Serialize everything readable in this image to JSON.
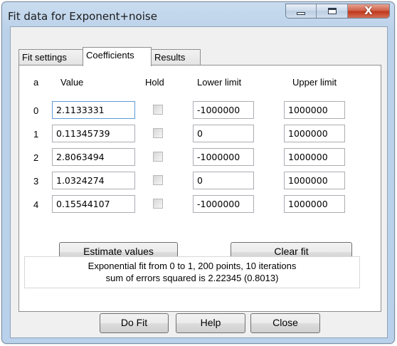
{
  "window": {
    "title": "Fit data for Exponent+noise"
  },
  "caption_buttons": {
    "close_glyph": "X"
  },
  "tabs": [
    {
      "label": "Fit settings",
      "active": false
    },
    {
      "label": "Coefficients",
      "active": true
    },
    {
      "label": "Results",
      "active": false
    }
  ],
  "coefficients": {
    "headers": {
      "index": "a",
      "value": "Value",
      "hold": "Hold",
      "lower": "Lower limit",
      "upper": "Upper limit"
    },
    "rows": [
      {
        "index": "0",
        "value": "2.1133331",
        "hold": false,
        "lower": "-1000000",
        "upper": "1000000"
      },
      {
        "index": "1",
        "value": "0.11345739",
        "hold": false,
        "lower": "0",
        "upper": "1000000"
      },
      {
        "index": "2",
        "value": "2.8063494",
        "hold": false,
        "lower": "-1000000",
        "upper": "1000000"
      },
      {
        "index": "3",
        "value": "1.0324274",
        "hold": false,
        "lower": "0",
        "upper": "1000000"
      },
      {
        "index": "4",
        "value": "0.15544107",
        "hold": false,
        "lower": "-1000000",
        "upper": "1000000"
      }
    ]
  },
  "buttons": {
    "estimate": "Estimate values",
    "clear": "Clear fit",
    "do_fit": "Do Fit",
    "help": "Help",
    "close": "Close"
  },
  "status": {
    "line1": "Exponential fit from 0 to 1, 200 points, 10 iterations",
    "line2": "sum of errors squared is 2.22345 (0.8013)"
  }
}
